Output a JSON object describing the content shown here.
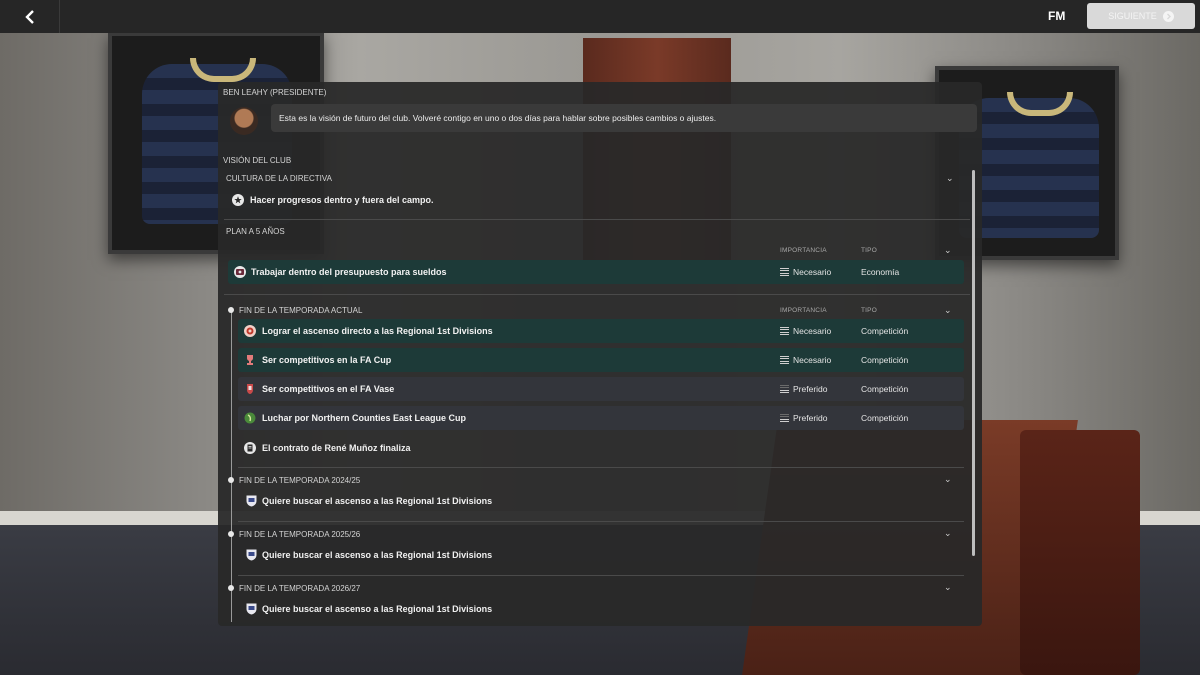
{
  "topbar": {
    "logo": "FM",
    "next_label": "SIGUIENTE"
  },
  "speaker": "BEN LEAHY (PRESIDENTE)",
  "message": "Esta es la visión de futuro del club. Volveré contigo en uno o dos días para hablar sobre posibles cambios o ajustes.",
  "vision_title": "VISIÓN DEL CLUB",
  "culture": {
    "label": "CULTURA DE LA DIRECTIVA",
    "item": "Hacer progresos dentro y fuera del campo."
  },
  "plan": {
    "label": "PLAN A 5 AÑOS",
    "col_importance": "IMPORTANCIA",
    "col_type": "TIPO",
    "rows": [
      {
        "text": "Trabajar dentro del presupuesto para sueldos",
        "importance": "Necesario",
        "type": "Economía"
      }
    ]
  },
  "current_season": {
    "label": "FIN DE LA TEMPORADA ACTUAL",
    "col_importance": "IMPORTANCIA",
    "col_type": "TIPO",
    "rows": [
      {
        "text": "Lograr el ascenso directo a las Regional 1st Divisions",
        "importance": "Necesario",
        "type": "Competición"
      },
      {
        "text": "Ser competitivos en la FA Cup",
        "importance": "Necesario",
        "type": "Competición"
      },
      {
        "text": "Ser competitivos en el FA Vase",
        "importance": "Preferido",
        "type": "Competición"
      },
      {
        "text": "Luchar por Northern Counties East League Cup",
        "importance": "Preferido",
        "type": "Competición"
      }
    ],
    "contract": "El contrato de René Muñoz finaliza"
  },
  "future": [
    {
      "label": "FIN DE LA TEMPORADA 2024/25",
      "item": "Quiere buscar el ascenso a las Regional 1st Divisions"
    },
    {
      "label": "FIN DE LA TEMPORADA 2025/26",
      "item": "Quiere buscar el ascenso a las Regional 1st Divisions"
    },
    {
      "label": "FIN DE LA TEMPORADA 2026/27",
      "item": "Quiere buscar el ascenso a las Regional 1st Divisions"
    }
  ],
  "colors": {
    "teal_row": "#1d3a38",
    "grey_row": "#33353b",
    "panel": "#282828"
  }
}
